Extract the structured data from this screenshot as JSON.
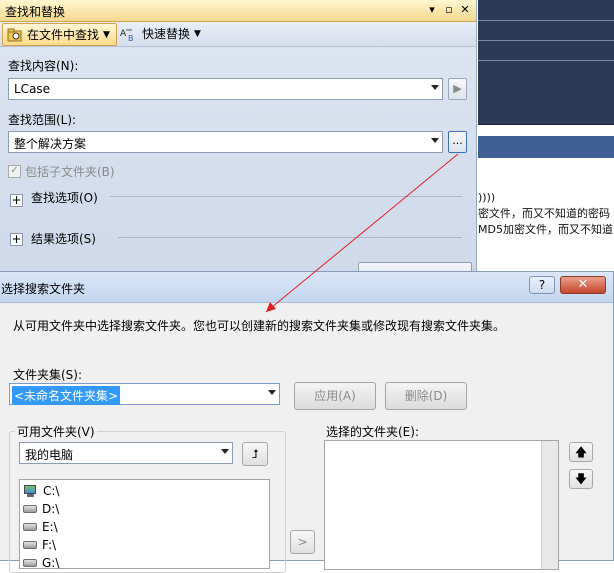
{
  "editor": {
    "lines": [
      "))))",
      "密文件，而又不知道的密码",
      "MD5加密文件，而又不知道"
    ]
  },
  "find_panel": {
    "title": "查找和替换",
    "toolbar": {
      "find_in_files": "在文件中查找",
      "quick_replace": "快速替换"
    },
    "find_what_label": "查找内容(N):",
    "find_what_value": "LCase",
    "look_in_label": "查找范围(L):",
    "look_in_value": "整个解决方案",
    "include_subfolders_label": "包括子文件夹(B)",
    "include_subfolders_checked": true,
    "find_options_label": "查找选项(O)",
    "result_options_label": "结果选项(S)",
    "browse_button": "..."
  },
  "dialog": {
    "title": "选择搜索文件夹",
    "description": "从可用文件夹中选择搜索文件夹。您也可以创建新的搜索文件夹集或修改现有搜索文件夹集。",
    "folder_set_label": "文件夹集(S):",
    "folder_set_value": "<未命名文件夹集>",
    "apply_button": "应用(A)",
    "delete_button": "删除(D)",
    "available_folders_label": "可用文件夹(V)",
    "available_location": "我的电脑",
    "available_items": [
      "C:\\",
      "D:\\",
      "E:\\",
      "F:\\",
      "G:\\"
    ],
    "selected_folders_label": "选择的文件夹(E):",
    "add_button": ">",
    "help_button": "?",
    "close_button": "✕"
  },
  "colors": {
    "selection": "#3399ff",
    "annotation_arrow": "#e02020"
  }
}
